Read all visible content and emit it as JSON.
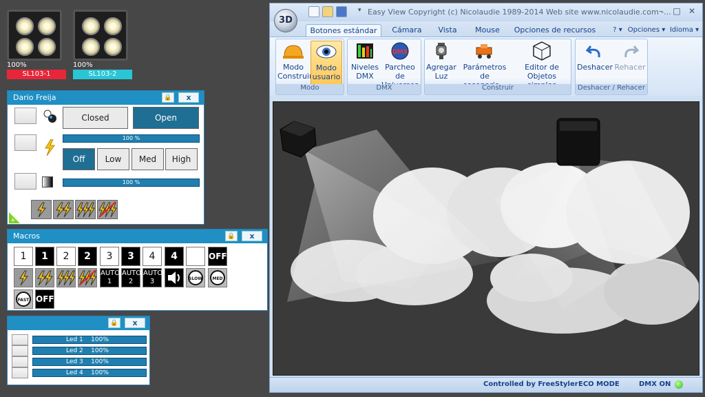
{
  "fixtures": [
    {
      "percent": "100%",
      "name": "SL103-1",
      "color": "#e8263a"
    },
    {
      "percent": "100%",
      "name": "SL103-2",
      "color": "#29c6d6"
    }
  ],
  "panel1": {
    "title": "Dario Freija",
    "closed_label": "Closed",
    "open_label": "Open",
    "bar1_text": "100 %",
    "bar2_text": "100 %",
    "speed_off": "Off",
    "speed_low": "Low",
    "speed_med": "Med",
    "speed_high": "High"
  },
  "panel2": {
    "title": "Macros",
    "row1": [
      "1",
      "1",
      "2",
      "2",
      "3",
      "3",
      "4",
      "4",
      "",
      "OFF"
    ],
    "auto": [
      "AUTO 1",
      "AUTO 2",
      "AUTO 3"
    ],
    "slow": "SLOW",
    "med": "MED",
    "fast": "FAST",
    "off2": "OFF"
  },
  "panel3": {
    "leds": [
      {
        "label": "Led 1",
        "value": "100%"
      },
      {
        "label": "Led 2",
        "value": "100%"
      },
      {
        "label": "Led 3",
        "value": "100%"
      },
      {
        "label": "Led 4",
        "value": "100%"
      }
    ]
  },
  "window": {
    "orb_text": "3D",
    "title": "Easy View   Copyright (c) Nicolaudie 1989-2014   Web site www.nicolaudie.com -...",
    "tabs": [
      "Botones estándar",
      "Cámara",
      "Vista",
      "Mouse",
      "Opciones de recursos"
    ],
    "right_tabs": [
      "? ▾",
      "Opciones ▾",
      "Idioma ▾"
    ],
    "groups": {
      "modo": "Modo",
      "dmx": "DMX",
      "construir": "Construir",
      "deshacer": "Deshacer / Rehacer"
    },
    "buttons": {
      "modo_construir": [
        "Modo",
        "Construir"
      ],
      "modo_usuario": [
        "Modo",
        "usuario"
      ],
      "niveles_dmx": [
        "Niveles",
        "DMX"
      ],
      "parcheo": [
        "Parcheo de",
        "Universos"
      ],
      "agregar_luz": [
        "Agregar",
        "Luz"
      ],
      "parametros": [
        "Parámetros de",
        "escenario..."
      ],
      "editor": [
        "Editor de",
        "Objetos simples"
      ],
      "deshacer": "Deshacer",
      "rehacer": "Rehacer"
    },
    "status": {
      "controlled": "Controlled by FreeStyler",
      "eco": "ECO MODE",
      "dmx": "DMX ON"
    }
  }
}
